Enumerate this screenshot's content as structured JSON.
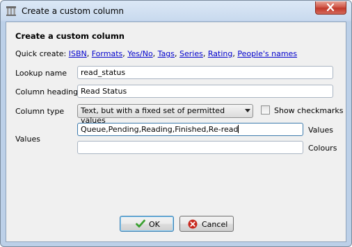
{
  "window": {
    "title": "Create a custom column",
    "icon": "library-columns-icon"
  },
  "heading": "Create a custom column",
  "quick_create": {
    "label": "Quick create:",
    "links": [
      "ISBN",
      "Formats",
      "Yes/No",
      "Tags",
      "Series",
      "Rating",
      "People's names"
    ],
    "separator": ", "
  },
  "fields": {
    "lookup_name": {
      "label": "Lookup name",
      "value": "read_status"
    },
    "column_heading": {
      "label": "Column heading",
      "value": "Read Status"
    },
    "column_type": {
      "label": "Column type",
      "selected": "Text, but with a fixed set of permitted values"
    },
    "show_checkmarks": {
      "label": "Show checkmarks",
      "checked": false
    },
    "values": {
      "label": "Values",
      "value": "Queue,Pending,Reading,Finished,Re-read",
      "side_label": "Values"
    },
    "colours": {
      "value": "",
      "side_label": "Colours"
    }
  },
  "buttons": {
    "ok": "OK",
    "cancel": "Cancel"
  },
  "colors": {
    "link": "#0000cc",
    "ok_icon": "#3aa030",
    "cancel_icon": "#c8281e"
  }
}
